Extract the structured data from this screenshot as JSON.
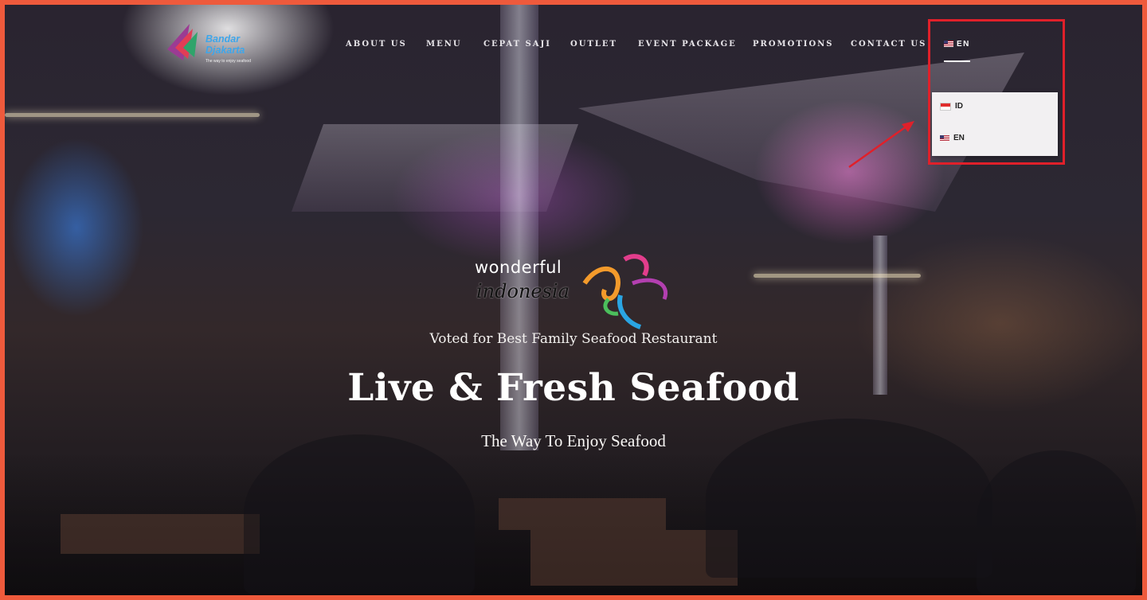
{
  "brand": {
    "name": "Bandar Djakarta",
    "tagline": "The way to enjoy seafood"
  },
  "nav": {
    "items": [
      {
        "label": "ABOUT US"
      },
      {
        "label": "MENU"
      },
      {
        "label": "CEPAT SAJI"
      },
      {
        "label": "OUTLET"
      },
      {
        "label": "EVENT PACKAGE"
      },
      {
        "label": "PROMOTIONS"
      },
      {
        "label": "CONTACT US"
      }
    ],
    "language": {
      "current": "EN",
      "current_flag": "us-flag-icon",
      "options": [
        {
          "label": "ID",
          "flag": "indonesia-flag-icon"
        },
        {
          "label": "EN",
          "flag": "us-flag-icon"
        }
      ]
    }
  },
  "hero": {
    "badge_line1": "wonderful",
    "badge_line2": "indonesia",
    "subtitle": "Voted for Best Family Seafood Restaurant",
    "title": "Live & Fresh Seafood",
    "tagline": "The Way To Enjoy Seafood"
  },
  "annotation": {
    "highlight_color": "#e0202a"
  }
}
